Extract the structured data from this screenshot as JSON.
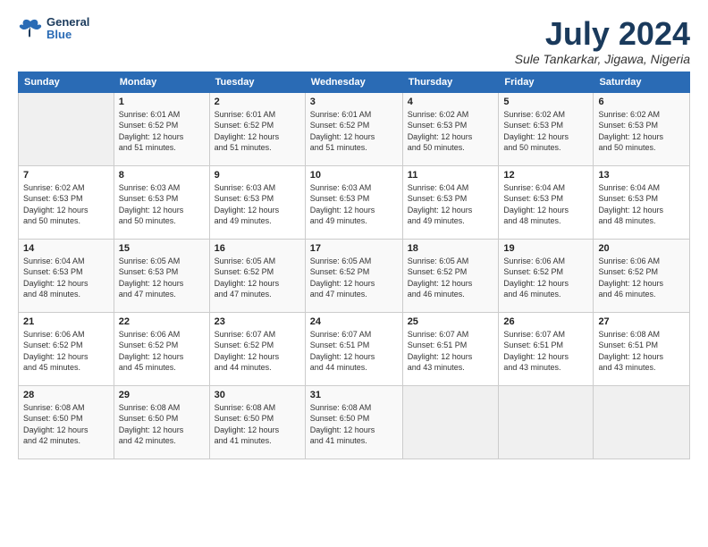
{
  "logo": {
    "line1": "General",
    "line2": "Blue"
  },
  "title": "July 2024",
  "subtitle": "Sule Tankarkar, Jigawa, Nigeria",
  "days_of_week": [
    "Sunday",
    "Monday",
    "Tuesday",
    "Wednesday",
    "Thursday",
    "Friday",
    "Saturday"
  ],
  "weeks": [
    [
      {
        "day": "",
        "detail": ""
      },
      {
        "day": "1",
        "detail": "Sunrise: 6:01 AM\nSunset: 6:52 PM\nDaylight: 12 hours\nand 51 minutes."
      },
      {
        "day": "2",
        "detail": "Sunrise: 6:01 AM\nSunset: 6:52 PM\nDaylight: 12 hours\nand 51 minutes."
      },
      {
        "day": "3",
        "detail": "Sunrise: 6:01 AM\nSunset: 6:52 PM\nDaylight: 12 hours\nand 51 minutes."
      },
      {
        "day": "4",
        "detail": "Sunrise: 6:02 AM\nSunset: 6:53 PM\nDaylight: 12 hours\nand 50 minutes."
      },
      {
        "day": "5",
        "detail": "Sunrise: 6:02 AM\nSunset: 6:53 PM\nDaylight: 12 hours\nand 50 minutes."
      },
      {
        "day": "6",
        "detail": "Sunrise: 6:02 AM\nSunset: 6:53 PM\nDaylight: 12 hours\nand 50 minutes."
      }
    ],
    [
      {
        "day": "7",
        "detail": "Sunrise: 6:02 AM\nSunset: 6:53 PM\nDaylight: 12 hours\nand 50 minutes."
      },
      {
        "day": "8",
        "detail": "Sunrise: 6:03 AM\nSunset: 6:53 PM\nDaylight: 12 hours\nand 50 minutes."
      },
      {
        "day": "9",
        "detail": "Sunrise: 6:03 AM\nSunset: 6:53 PM\nDaylight: 12 hours\nand 49 minutes."
      },
      {
        "day": "10",
        "detail": "Sunrise: 6:03 AM\nSunset: 6:53 PM\nDaylight: 12 hours\nand 49 minutes."
      },
      {
        "day": "11",
        "detail": "Sunrise: 6:04 AM\nSunset: 6:53 PM\nDaylight: 12 hours\nand 49 minutes."
      },
      {
        "day": "12",
        "detail": "Sunrise: 6:04 AM\nSunset: 6:53 PM\nDaylight: 12 hours\nand 48 minutes."
      },
      {
        "day": "13",
        "detail": "Sunrise: 6:04 AM\nSunset: 6:53 PM\nDaylight: 12 hours\nand 48 minutes."
      }
    ],
    [
      {
        "day": "14",
        "detail": "Sunrise: 6:04 AM\nSunset: 6:53 PM\nDaylight: 12 hours\nand 48 minutes."
      },
      {
        "day": "15",
        "detail": "Sunrise: 6:05 AM\nSunset: 6:53 PM\nDaylight: 12 hours\nand 47 minutes."
      },
      {
        "day": "16",
        "detail": "Sunrise: 6:05 AM\nSunset: 6:52 PM\nDaylight: 12 hours\nand 47 minutes."
      },
      {
        "day": "17",
        "detail": "Sunrise: 6:05 AM\nSunset: 6:52 PM\nDaylight: 12 hours\nand 47 minutes."
      },
      {
        "day": "18",
        "detail": "Sunrise: 6:05 AM\nSunset: 6:52 PM\nDaylight: 12 hours\nand 46 minutes."
      },
      {
        "day": "19",
        "detail": "Sunrise: 6:06 AM\nSunset: 6:52 PM\nDaylight: 12 hours\nand 46 minutes."
      },
      {
        "day": "20",
        "detail": "Sunrise: 6:06 AM\nSunset: 6:52 PM\nDaylight: 12 hours\nand 46 minutes."
      }
    ],
    [
      {
        "day": "21",
        "detail": "Sunrise: 6:06 AM\nSunset: 6:52 PM\nDaylight: 12 hours\nand 45 minutes."
      },
      {
        "day": "22",
        "detail": "Sunrise: 6:06 AM\nSunset: 6:52 PM\nDaylight: 12 hours\nand 45 minutes."
      },
      {
        "day": "23",
        "detail": "Sunrise: 6:07 AM\nSunset: 6:52 PM\nDaylight: 12 hours\nand 44 minutes."
      },
      {
        "day": "24",
        "detail": "Sunrise: 6:07 AM\nSunset: 6:51 PM\nDaylight: 12 hours\nand 44 minutes."
      },
      {
        "day": "25",
        "detail": "Sunrise: 6:07 AM\nSunset: 6:51 PM\nDaylight: 12 hours\nand 43 minutes."
      },
      {
        "day": "26",
        "detail": "Sunrise: 6:07 AM\nSunset: 6:51 PM\nDaylight: 12 hours\nand 43 minutes."
      },
      {
        "day": "27",
        "detail": "Sunrise: 6:08 AM\nSunset: 6:51 PM\nDaylight: 12 hours\nand 43 minutes."
      }
    ],
    [
      {
        "day": "28",
        "detail": "Sunrise: 6:08 AM\nSunset: 6:50 PM\nDaylight: 12 hours\nand 42 minutes."
      },
      {
        "day": "29",
        "detail": "Sunrise: 6:08 AM\nSunset: 6:50 PM\nDaylight: 12 hours\nand 42 minutes."
      },
      {
        "day": "30",
        "detail": "Sunrise: 6:08 AM\nSunset: 6:50 PM\nDaylight: 12 hours\nand 41 minutes."
      },
      {
        "day": "31",
        "detail": "Sunrise: 6:08 AM\nSunset: 6:50 PM\nDaylight: 12 hours\nand 41 minutes."
      },
      {
        "day": "",
        "detail": ""
      },
      {
        "day": "",
        "detail": ""
      },
      {
        "day": "",
        "detail": ""
      }
    ]
  ]
}
